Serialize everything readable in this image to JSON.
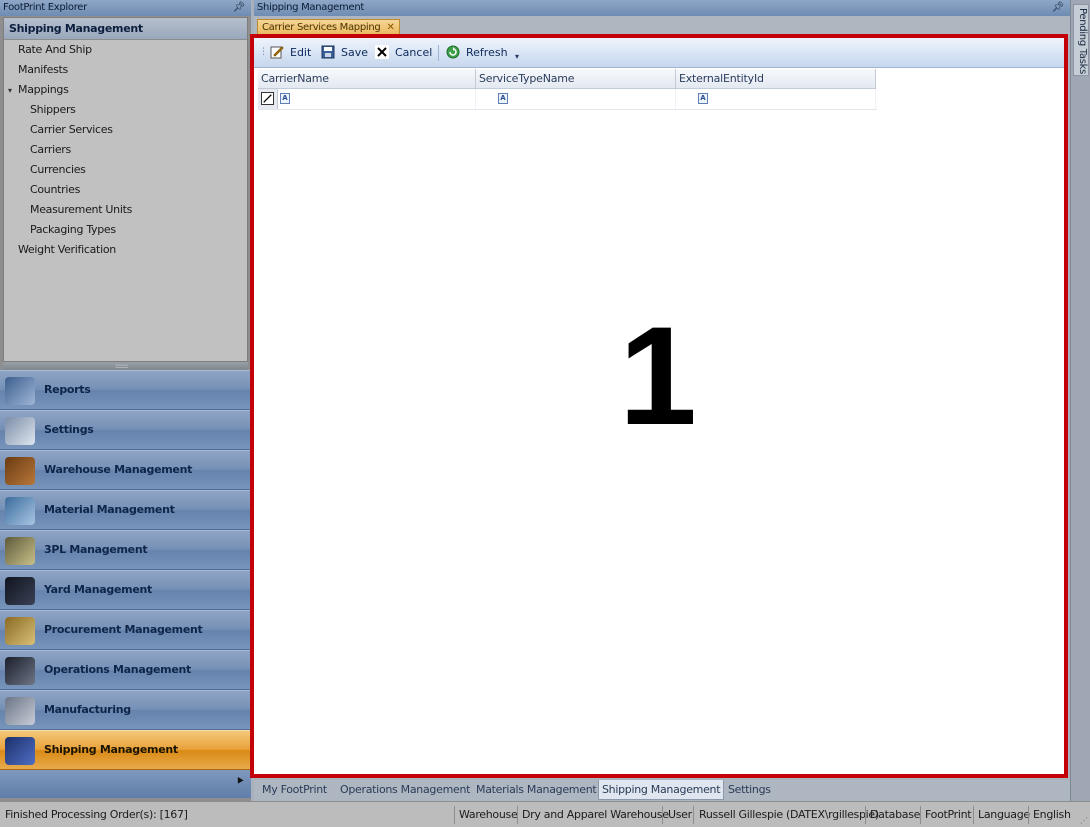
{
  "explorer": {
    "title": "FootPrint Explorer",
    "header": "Shipping Management",
    "tree": [
      {
        "label": "Rate And Ship",
        "level": 1
      },
      {
        "label": "Manifests",
        "level": 1
      },
      {
        "label": "Mappings",
        "level": 1,
        "expanded": true
      },
      {
        "label": "Shippers",
        "level": 2
      },
      {
        "label": "Carrier Services",
        "level": 2
      },
      {
        "label": "Carriers",
        "level": 2
      },
      {
        "label": "Currencies",
        "level": 2
      },
      {
        "label": "Countries",
        "level": 2
      },
      {
        "label": "Measurement Units",
        "level": 2
      },
      {
        "label": "Packaging Types",
        "level": 2
      },
      {
        "label": "Weight Verification",
        "level": 1
      }
    ],
    "modules": [
      {
        "label": "Reports",
        "icon": "reports-icon"
      },
      {
        "label": "Settings",
        "icon": "settings-icon"
      },
      {
        "label": "Warehouse Management",
        "icon": "warehouse-icon"
      },
      {
        "label": "Material Management",
        "icon": "material-icon"
      },
      {
        "label": "3PL Management",
        "icon": "3pl-icon"
      },
      {
        "label": "Yard Management",
        "icon": "yard-icon"
      },
      {
        "label": "Procurement Management",
        "icon": "procurement-icon"
      },
      {
        "label": "Operations Management",
        "icon": "operations-icon"
      },
      {
        "label": "Manufacturing",
        "icon": "manufacturing-icon"
      },
      {
        "label": "Shipping Management",
        "icon": "shipping-icon",
        "active": true
      }
    ]
  },
  "main": {
    "title": "Shipping Management",
    "doc_tab": "Carrier Services Mapping",
    "toolbar": {
      "edit": "Edit",
      "save": "Save",
      "cancel": "Cancel",
      "refresh": "Refresh"
    },
    "grid": {
      "columns": [
        "CarrierName",
        "ServiceTypeName",
        "ExternalEntityId"
      ]
    },
    "annotation": "1"
  },
  "side_panel": {
    "label": "Pending Tasks"
  },
  "bottom_tabs": [
    "My FootPrint",
    "Operations Management",
    "Materials Management",
    "Shipping Management",
    "Settings"
  ],
  "status": {
    "message": "Finished Processing Order(s): [167]",
    "warehouse_label": "Warehouse",
    "warehouse_value": "Dry and Apparel Warehouse",
    "user_label": "User",
    "user_value": "Russell Gillespie (DATEX\\rgillespie)",
    "database_label": "Database",
    "database_value": "FootPrint",
    "language_label": "Language",
    "language_value": "English"
  },
  "colors": {
    "highlight_frame": "#c40008",
    "active_module": "#e9a23b",
    "module_blue": "#7690b6"
  }
}
